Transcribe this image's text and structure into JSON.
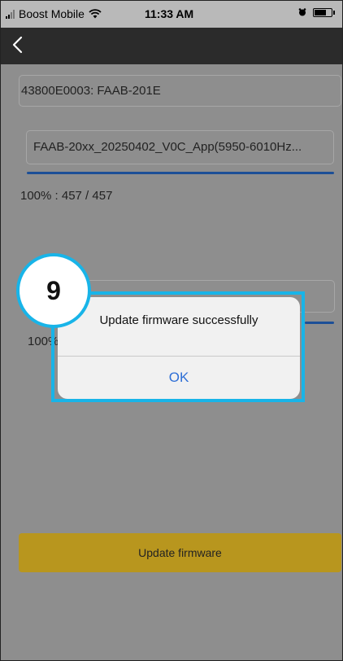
{
  "status_bar": {
    "carrier": "Boost Mobile",
    "time": "11:33 AM",
    "icons": [
      "signal-icon",
      "wifi-icon",
      "alarm-icon",
      "battery-icon"
    ]
  },
  "nav": {
    "back_icon": "chevron-left-icon"
  },
  "device": {
    "label": "43800E0003: FAAB-201E"
  },
  "firmware_file": {
    "name": "FAAB-20xx_20250402_V0C_App(5950-6010Hz...",
    "progress_fraction": 1.0,
    "progress_text": "100% : 457 / 457"
  },
  "second_progress": {
    "partial_text": "100%"
  },
  "dialog": {
    "message": "Update firmware successfully",
    "ok_label": "OK"
  },
  "step_badge": {
    "number": "9"
  },
  "update_button": {
    "label": "Update firmware"
  },
  "colors": {
    "accent": "#18b4e8",
    "button": "#b8961e",
    "progress": "#1c4f97",
    "link": "#2f6fd6"
  }
}
